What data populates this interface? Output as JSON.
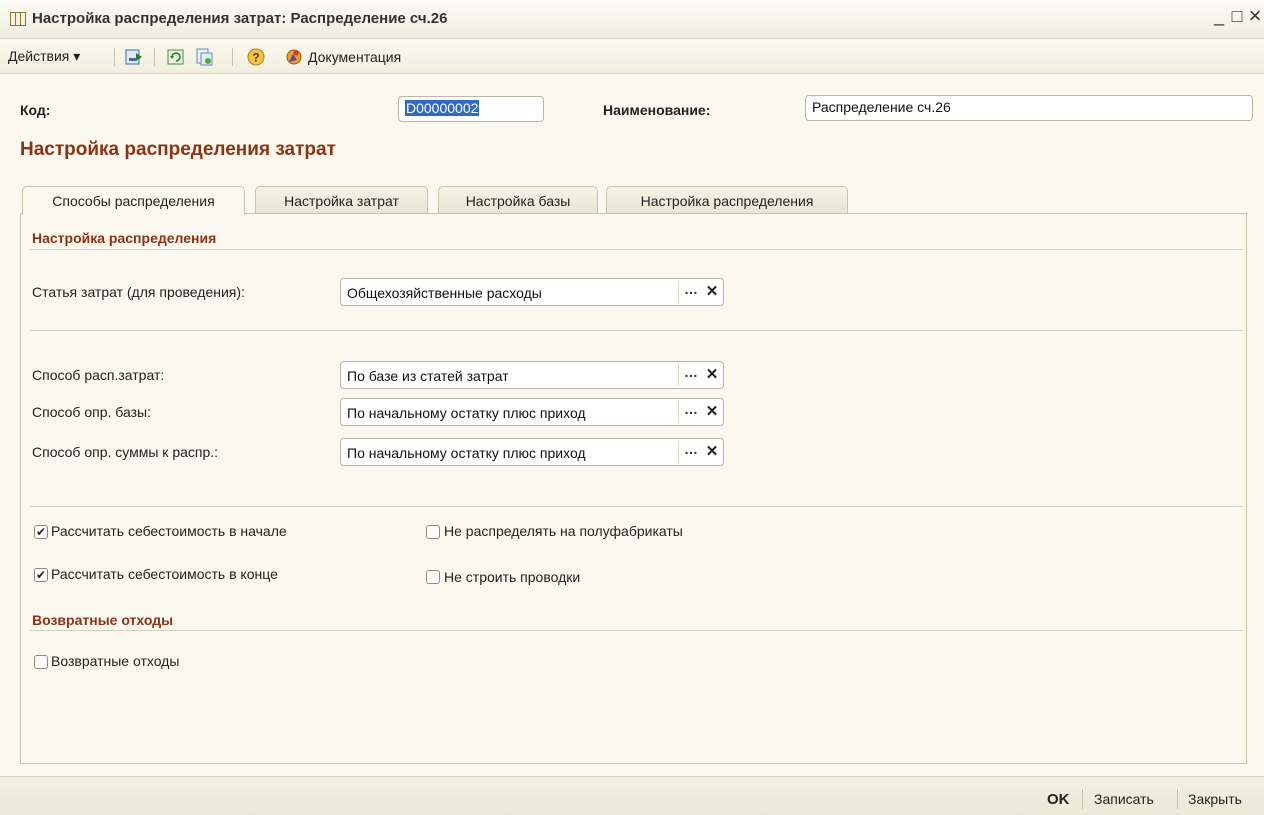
{
  "window": {
    "title": "Настройка распределения затрат: Распределение сч.26",
    "minimize": "_",
    "maximize": "□",
    "close": "×"
  },
  "toolbar": {
    "actions_label": "Действия ▾",
    "documentation_label": "Документация",
    "icons": [
      "save-close-icon",
      "refresh-icon",
      "copy-icon",
      "help-icon",
      "documentation-icon"
    ]
  },
  "header": {
    "code_label": "Код:",
    "code_value": "D00000002",
    "name_label": "Наименование:",
    "name_value": "Распределение сч.26"
  },
  "section_title": "Настройка распределения затрат",
  "tabs": [
    {
      "label": "Способы распределения",
      "active": true
    },
    {
      "label": "Настройка затрат",
      "active": false
    },
    {
      "label": "Настройка базы",
      "active": false
    },
    {
      "label": "Настройка распределения",
      "active": false
    }
  ],
  "panel": {
    "group1_title": "Настройка распределения",
    "cost_item_label": "Статья затрат (для проведения):",
    "cost_item_value": "Общехозяйственные расходы",
    "method_label": "Способ расп.затрат:",
    "method_value": "По базе из статей затрат",
    "base_label": "Способ опр. базы:",
    "base_value": "По начальному остатку плюс приход",
    "sum_label": "Способ опр. суммы к распр.:",
    "sum_value": "По начальному остатку плюс приход",
    "calc_start_label": "Рассчитать себестоимость в начале",
    "calc_start_checked": true,
    "calc_end_label": "Рассчитать себестоимость в конце",
    "calc_end_checked": true,
    "no_semi_label": "Не распределять на полуфабрикаты",
    "no_semi_checked": false,
    "no_entries_label": "Не строить проводки",
    "no_entries_checked": false,
    "group2_title": "Возвратные отходы",
    "returnable_label": "Возвратные отходы",
    "returnable_checked": false
  },
  "footer": {
    "ok_label": "OK",
    "save_label": "Записать",
    "close_label": "Закрыть"
  },
  "colors": {
    "accent": "#8a3414",
    "background": "#fbf9ef",
    "selection": "#316ac5"
  }
}
